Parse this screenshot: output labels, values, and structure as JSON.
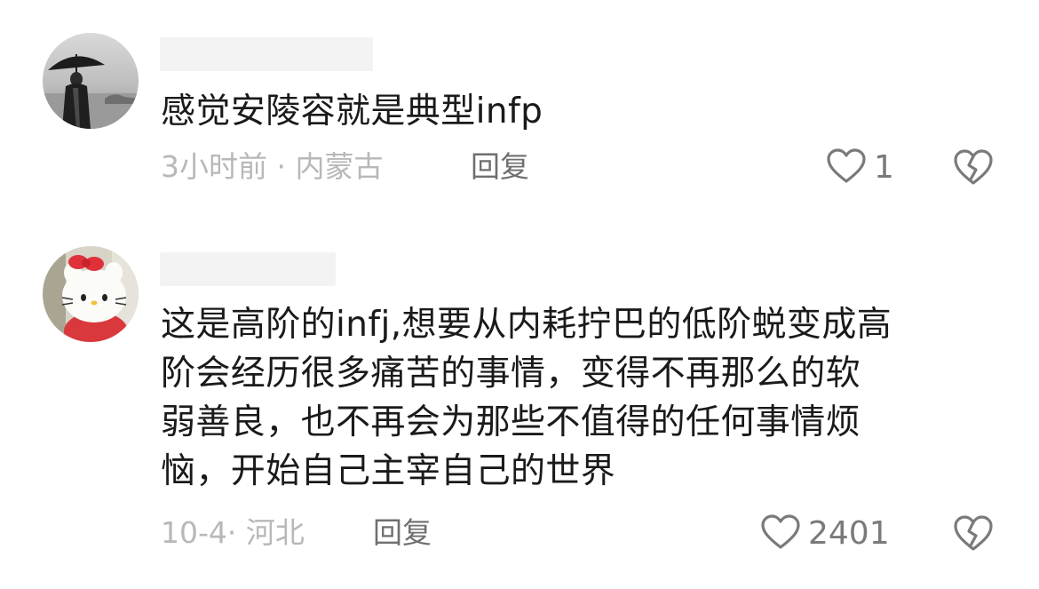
{
  "comments": [
    {
      "text": "感觉安陵容就是典型infp",
      "time": "3小时前",
      "separator": " · ",
      "location": "内蒙古",
      "reply_label": "回复",
      "likes": "1",
      "like_icon": "heart-outline-icon",
      "dislike_icon": "broken-heart-icon",
      "avatar": "avatar-person-with-umbrella"
    },
    {
      "text": "这是高阶的infj,想要从内耗拧巴的低阶蜕变成高\n阶会经历很多痛苦的事情，变得不再那么的软\n弱善良，也不再会为那些不值得的任何事情烦\n恼，开始自己主宰自己的世界",
      "time": "10-4",
      "separator": "· ",
      "location": "河北",
      "reply_label": "回复",
      "likes": "2401",
      "like_icon": "heart-outline-icon",
      "dislike_icon": "broken-heart-icon",
      "avatar": "avatar-hello-kitty"
    }
  ],
  "colors": {
    "text": "#1a1a1a",
    "meta": "#b8b8b8",
    "reply": "#6f6f6f",
    "icon": "#7a7a7a"
  }
}
